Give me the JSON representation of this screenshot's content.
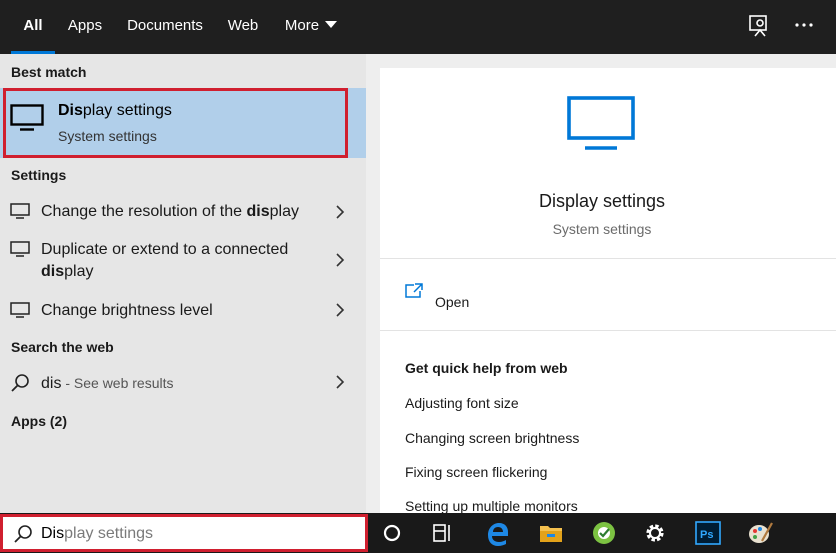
{
  "tabs": [
    "All",
    "Apps",
    "Documents",
    "Web",
    "More"
  ],
  "left_panel": {
    "best_match_heading": "Best match",
    "best_match": {
      "title_bold": "Dis",
      "title_rest": "play settings",
      "subtitle": "System settings"
    },
    "settings_heading": "Settings",
    "settings_items": [
      {
        "before": "Change the resolution of the ",
        "bold": "dis",
        "after": "play"
      },
      {
        "before": "Duplicate or extend to a connected ",
        "bold": "dis",
        "after": "play"
      },
      {
        "before": "Change brightness level",
        "bold": "",
        "after": ""
      }
    ],
    "web_heading": "Search the web",
    "web_item": {
      "query": "dis",
      "suffix": " - See web results"
    },
    "apps_heading": "Apps (2)"
  },
  "preview": {
    "title": "Display settings",
    "subtitle": "System settings",
    "open_label": "Open",
    "help_heading": "Get quick help from web",
    "help_links": [
      "Adjusting font size",
      "Changing screen brightness",
      "Fixing screen flickering",
      "Setting up multiple monitors"
    ]
  },
  "taskbar": {
    "search_typed": "Dis",
    "search_completion": "play settings",
    "icons": [
      "cortana-icon",
      "task-view-icon",
      "edge-icon",
      "file-explorer-icon",
      "green-app-icon",
      "settings-gear-icon",
      "photoshop-icon",
      "paint-icon"
    ],
    "photoshop_label": "Ps"
  },
  "colors": {
    "accent": "#0078d7",
    "highlight": "#b1cfea",
    "annotation_red": "#d01f2f"
  }
}
